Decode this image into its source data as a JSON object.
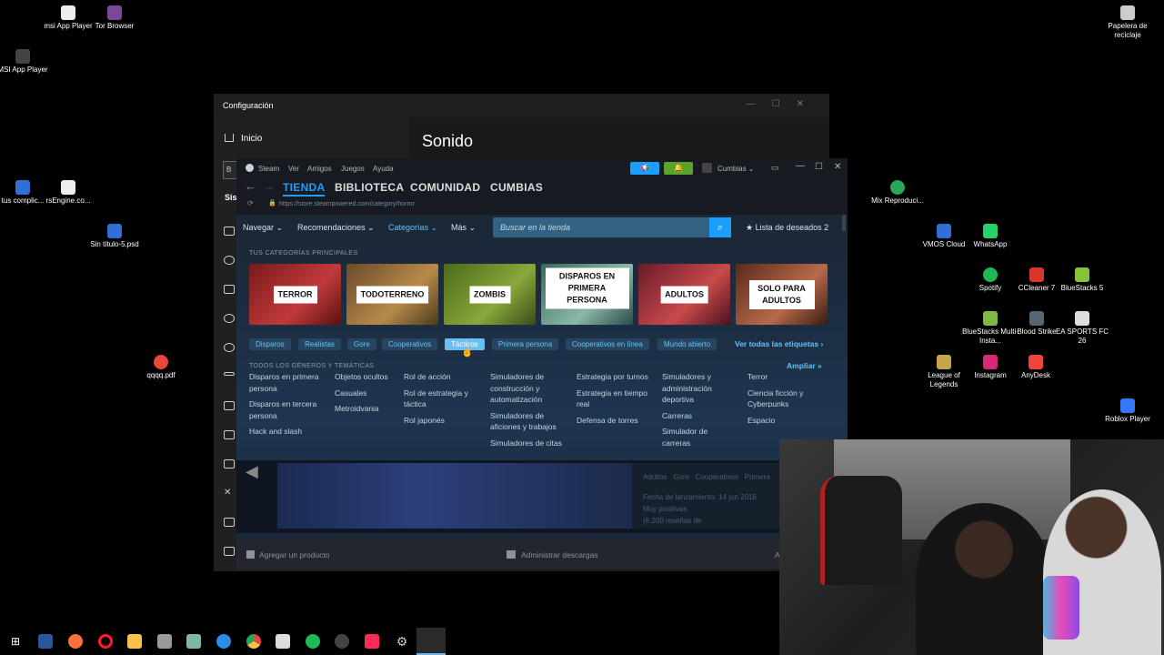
{
  "desktop": {
    "icons": [
      {
        "label": "msi App Player",
        "color": "#eeeeee"
      },
      {
        "label": "Tor Browser",
        "color": "#7d4698"
      },
      {
        "label": "MSI App Player",
        "color": "#444444"
      },
      {
        "label": "tus complic...",
        "color": "#2f6fd6"
      },
      {
        "label": "rsEngine.co...",
        "color": "#eeeeee"
      },
      {
        "label": "Sin título-5.psd",
        "color": "#2f6fd6"
      },
      {
        "label": "qqqq.pdf",
        "color": "#e8453c"
      },
      {
        "label": "Papelera de reciclaje",
        "color": "#cccccc"
      },
      {
        "label": "Mix Reproduci...",
        "color": "#2aa55a"
      },
      {
        "label": "VMOS Cloud",
        "color": "#2f6fd6"
      },
      {
        "label": "WhatsApp",
        "color": "#25d366"
      },
      {
        "label": "Spotify",
        "color": "#1db954"
      },
      {
        "label": "CCleaner 7",
        "color": "#d8362c"
      },
      {
        "label": "BlueStacks 5",
        "color": "#86c33b"
      },
      {
        "label": "BlueStacks Multi-Insta...",
        "color": "#7fb843"
      },
      {
        "label": "Blood Strike",
        "color": "#556677"
      },
      {
        "label": "EA SPORTS FC 26",
        "color": "#dddddd"
      },
      {
        "label": "League of Legends",
        "color": "#c7a34a"
      },
      {
        "label": "Instagram",
        "color": "#d62976"
      },
      {
        "label": "AnyDesk",
        "color": "#ef443b"
      },
      {
        "label": "Roblox Player",
        "color": "#3478f6"
      }
    ]
  },
  "settings_window": {
    "title": "Configuración",
    "home_label": "Inicio",
    "page_title": "Sonido",
    "cut_off_section": "Sist"
  },
  "steam": {
    "menu": {
      "app": "Steam",
      "items": [
        "Ver",
        "Amigos",
        "Juegos",
        "Ayuda"
      ],
      "user": "Cumbias"
    },
    "nav_tabs": [
      "TIENDA",
      "BIBLIOTECA",
      "COMUNIDAD",
      "CUMBIAS"
    ],
    "url": "https://store.steampowered.com/category/horror",
    "store_nav": {
      "items": [
        "Navegar",
        "Recomendaciones",
        "Categorías",
        "Más"
      ],
      "search_placeholder": "Buscar en la tienda",
      "wishlist": "Lista de deseados 2"
    },
    "top_categories_title": "TUS CATEGORÍAS PRINCIPALES",
    "categories": [
      {
        "label": "TERROR",
        "colors": [
          "#7a1a1a",
          "#c23a3a"
        ]
      },
      {
        "label": "TODOTERRENO",
        "colors": [
          "#6a4a2a",
          "#b88a4a"
        ]
      },
      {
        "label": "ZOMBIS",
        "colors": [
          "#4a6a1a",
          "#8aa83a"
        ]
      },
      {
        "label": "DISPAROS EN PRIMERA PERSONA",
        "colors": [
          "#3a6a5a",
          "#8ab8a8"
        ]
      },
      {
        "label": "ADULTOS",
        "colors": [
          "#6a1a2a",
          "#c84a4a"
        ]
      },
      {
        "label": "SOLO PARA ADULTOS",
        "colors": [
          "#5a2a1a",
          "#b86a4a"
        ]
      }
    ],
    "tags": [
      "Disparos",
      "Realistas",
      "Gore",
      "Cooperativos",
      "Tácticos",
      "Primera persona",
      "Cooperativos en línea",
      "Mundo abierto"
    ],
    "active_tag": "Tácticos",
    "see_all_tags": "Ver todas las etiquetas",
    "genres_title": "TODOS LOS GÉNEROS Y TEMÁTICAS",
    "expand": "Ampliar",
    "genre_columns": [
      [
        "Disparos en primera persona",
        "Disparos en tercera persona",
        "Hack and slash"
      ],
      [
        "Objetos ocultos",
        "Casuales",
        "Metroidvania"
      ],
      [
        "Rol de acción",
        "Rol de estrategia y táctica",
        "Rol japonés"
      ],
      [
        "Simuladores de construcción y automatización",
        "Simuladores de aficiones y trabajos",
        "Simuladores de citas"
      ],
      [
        "Estrategia por turnos",
        "Estrategia en tiempo real",
        "Defensa de torres"
      ],
      [
        "Simuladores y administración deportiva",
        "Carreras",
        "Simulador de carreras"
      ],
      [
        "Terror",
        "Ciencia ficción y Cyberpunks",
        "Espacio"
      ]
    ],
    "feature": {
      "tags": [
        "Adultos",
        "Gore",
        "Cooperativos",
        "Primera"
      ],
      "release": "Fecha de lanzamiento: 14 jun 2016",
      "rating": "Muy positivas",
      "reviews": "(6.200 reseñas de"
    },
    "footer": {
      "add_product": "Agregar un producto",
      "downloads": "Administrar descargas",
      "friends": "A"
    }
  },
  "taskbar": {
    "icons": [
      {
        "name": "windows-start-icon",
        "color": "#ffffff"
      },
      {
        "name": "word-icon",
        "color": "#2b579a"
      },
      {
        "name": "firefox-icon",
        "color": "#ff7139"
      },
      {
        "name": "opera-icon",
        "color": "#ff1b2d"
      },
      {
        "name": "file-explorer-icon",
        "color": "#f8c24a"
      },
      {
        "name": "app-icon",
        "color": "#999999"
      },
      {
        "name": "notepad-icon",
        "color": "#7fb8a4"
      },
      {
        "name": "edge-icon",
        "color": "#2a8ce8"
      },
      {
        "name": "chrome-icon",
        "color": "#e8453c"
      },
      {
        "name": "capcut-icon",
        "color": "#dddddd"
      },
      {
        "name": "spotify-icon",
        "color": "#1db954"
      },
      {
        "name": "obs-icon",
        "color": "#444444"
      },
      {
        "name": "tiktok-icon",
        "color": "#fe2c55"
      },
      {
        "name": "settings-icon",
        "color": "#cccccc"
      },
      {
        "name": "steam-icon",
        "color": "#1b2838"
      }
    ]
  }
}
